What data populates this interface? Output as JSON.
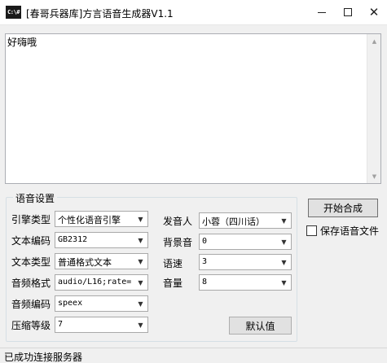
{
  "window": {
    "title": "[春哥兵器库]方言语音生成器V1.1",
    "icon_text": "C:\\#",
    "icons": {
      "minimize": "minimize-icon",
      "maximize": "maximize-icon",
      "close": "close-icon"
    }
  },
  "editor": {
    "text": "好嗨哦"
  },
  "settings": {
    "group_title": "语音设置",
    "engine_type": {
      "label": "引擎类型",
      "value": "个性化语音引擎"
    },
    "text_encoding": {
      "label": "文本编码",
      "value": "GB2312"
    },
    "text_type": {
      "label": "文本类型",
      "value": "普通格式文本"
    },
    "audio_format": {
      "label": "音频格式",
      "value": "audio/L16;rate="
    },
    "audio_codec": {
      "label": "音频编码",
      "value": "speex"
    },
    "compression_level": {
      "label": "压缩等级",
      "value": "7"
    },
    "speaker": {
      "label": "发音人",
      "value": "小蓉（四川话）"
    },
    "background_sound": {
      "label": "背景音",
      "value": "0"
    },
    "speed": {
      "label": "语速",
      "value": "3"
    },
    "volume": {
      "label": "音量",
      "value": "8"
    },
    "default_button": "默认值"
  },
  "actions": {
    "start_button": "开始合成",
    "save_checkbox_label": "保存语音文件",
    "save_checked": false
  },
  "status": {
    "text": "已成功连接服务器"
  }
}
